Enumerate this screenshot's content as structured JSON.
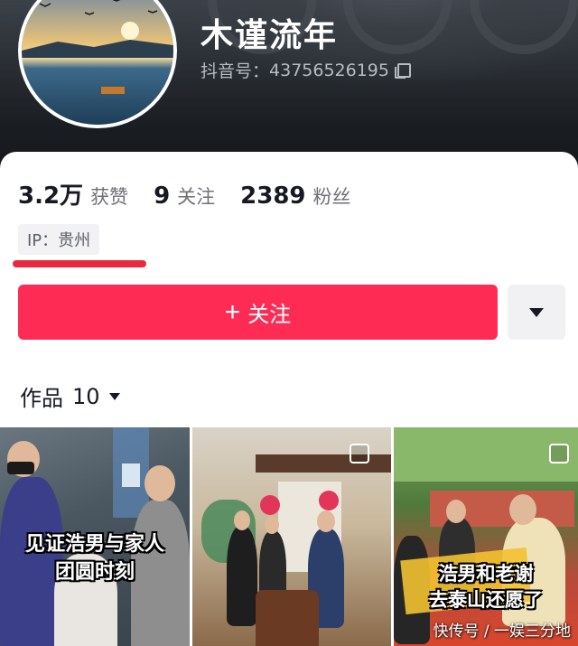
{
  "profile": {
    "nickname": "木谨流年",
    "uid_label": "抖音号：",
    "uid_value": "43756526195",
    "ip_label": "IP：贵州"
  },
  "stats": [
    {
      "value": "3.2万",
      "label": "获赞"
    },
    {
      "value": "9",
      "label": "关注"
    },
    {
      "value": "2389",
      "label": "粉丝"
    }
  ],
  "actions": {
    "follow_label": "关注",
    "follow_plus": "+"
  },
  "works": {
    "tab_label": "作品",
    "count": "10"
  },
  "thumbnails": [
    {
      "caption_line1": "见证浩男与家人",
      "caption_line2": "团圆时刻"
    },
    {
      "caption_line1": "",
      "caption_line2": ""
    },
    {
      "caption_line1": "浩男和老谢",
      "caption_line2": "去泰山还愿了"
    }
  ],
  "watermark": "快传号 / 一娱三分地",
  "colors": {
    "follow_button": "#fe2c55",
    "underline_highlight": "#e8293f"
  },
  "icons": [
    "copy-icon",
    "chevron-down-icon",
    "caret-down-icon",
    "checkbox-icon"
  ]
}
